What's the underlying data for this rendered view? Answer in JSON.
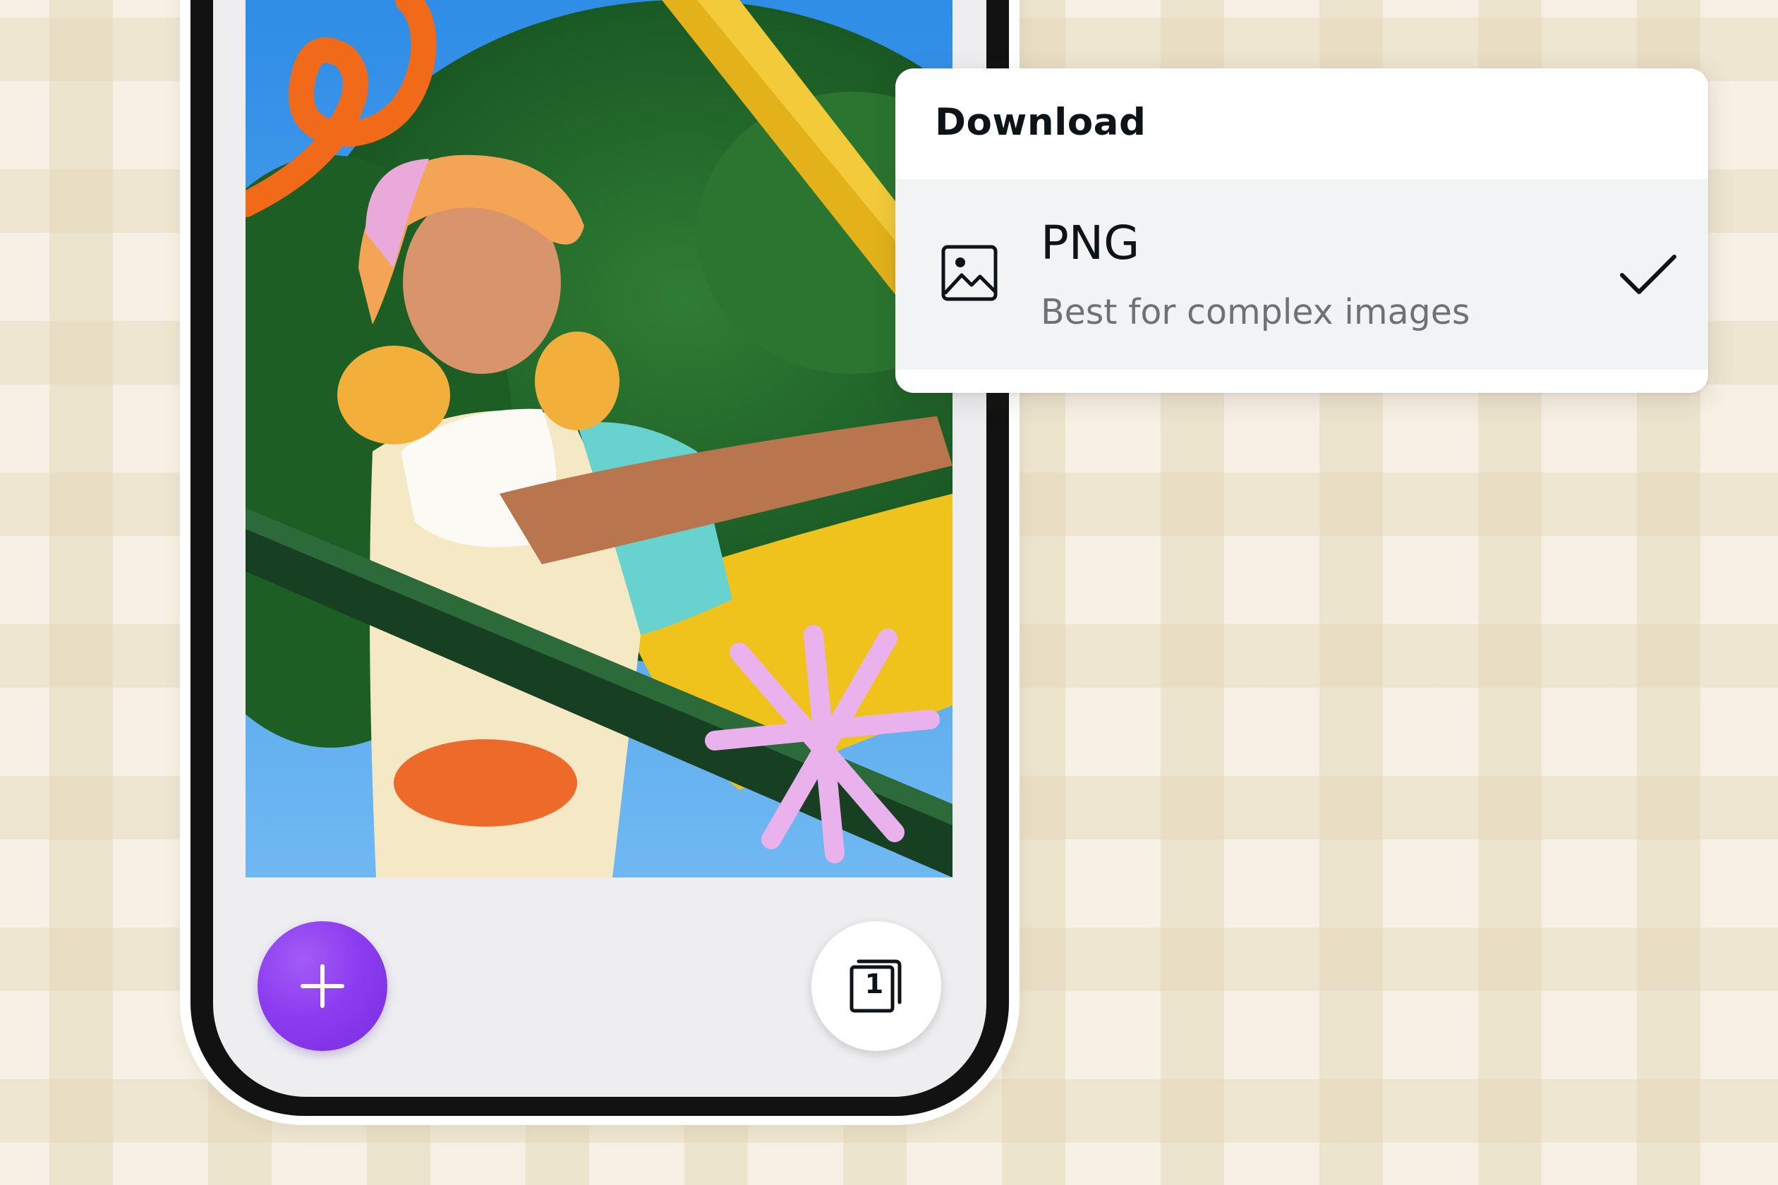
{
  "download_menu": {
    "title": "Download",
    "selected_format": {
      "name": "PNG",
      "description": "Best for complex images",
      "icon": "image-icon",
      "selected": true,
      "check_icon": "checkmark-icon"
    }
  },
  "phone": {
    "add_button": {
      "icon": "plus-icon",
      "color": "#8d3df0"
    },
    "pages_button": {
      "icon": "pages-icon",
      "count": "1"
    }
  },
  "colors": {
    "background": "#f6f1e4",
    "accent_purple": "#8d3df0",
    "panel_row": "#f2f3f5",
    "text_primary": "#0e1318",
    "text_secondary": "#6e7277"
  }
}
